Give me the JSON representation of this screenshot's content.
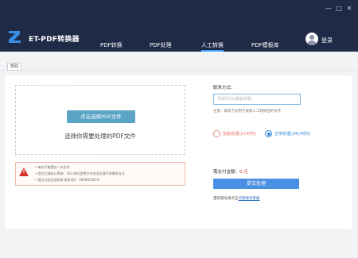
{
  "app": {
    "title": "ET-PDF转换器",
    "brand_color": "#1f2a47",
    "accent_color": "#4a90e2"
  },
  "nav": {
    "items": [
      {
        "label": "PDF转换",
        "active": false
      },
      {
        "label": "PDF处理",
        "active": false
      },
      {
        "label": "人工转换",
        "active": true
      },
      {
        "label": "PDF模板库",
        "active": false
      }
    ]
  },
  "user": {
    "login_label": "登录"
  },
  "window_controls": {
    "minimize": "—",
    "maximize": "□",
    "close": "✕"
  },
  "subbar": {
    "help_label": "帮助"
  },
  "upload": {
    "button_label": "点击选择PDF文件",
    "hint": "选择你需要处理的PDF文件"
  },
  "notice": {
    "lines": [
      "• 每次只能提交一次文件",
      "• 提交后请耐心等待，24小时内会将文件发送至填写的联系方式",
      "• 提交过程出现异常 联系QQ：2069423619"
    ]
  },
  "contact": {
    "label": "联系方式：",
    "placeholder": "请填写QQ或者邮箱",
    "note": "注意：联系方式用于接收人工转换后的文件"
  },
  "priority": {
    "urgent_label": "加急处理(2小时内)",
    "normal_label": "正常处理(24小时内)",
    "selected": "normal"
  },
  "fee": {
    "label": "需支付金额：",
    "value": "0 元"
  },
  "submit": {
    "label": "提交处理"
  },
  "support": {
    "prefix": "遇到错误请点击",
    "link": "点我联系客服"
  }
}
